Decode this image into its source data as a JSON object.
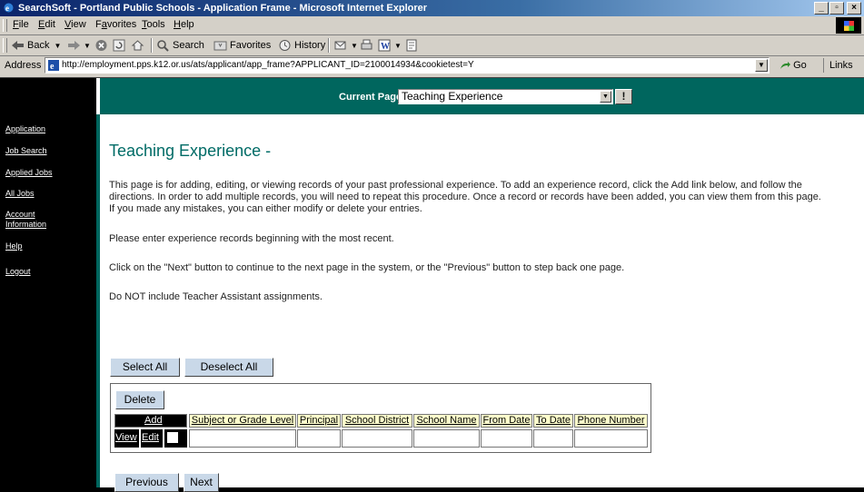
{
  "window": {
    "title": "SearchSoft - Portland Public Schools - Application Frame - Microsoft Internet Explorer"
  },
  "menubar": {
    "items": [
      {
        "hot": "F",
        "rest": "ile"
      },
      {
        "hot": "E",
        "rest": "dit"
      },
      {
        "hot": "V",
        "rest": "iew"
      },
      {
        "pre": "F",
        "hot": "a",
        "rest": "vorites"
      },
      {
        "hot": "T",
        "rest": "ools"
      },
      {
        "hot": "H",
        "rest": "elp"
      }
    ]
  },
  "toolbar": {
    "back": "Back",
    "search": "Search",
    "favorites": "Favorites",
    "history": "History"
  },
  "addressbar": {
    "label": "Address",
    "url": "http://employment.pps.k12.or.us/ats/applicant/app_frame?APPLICANT_ID=2100014934&cookietest=Y",
    "go": "Go",
    "links": "Links"
  },
  "sidebar": {
    "items": [
      {
        "label": "Application"
      },
      {
        "label": "Job Search"
      },
      {
        "label": "Applied Jobs"
      },
      {
        "label": "All Jobs"
      },
      {
        "label": "Account"
      },
      {
        "label": "Information"
      },
      {
        "label": "Help"
      },
      {
        "label": "Logout"
      }
    ]
  },
  "topband": {
    "current_page_label": "Current Page:",
    "current_page_value": "Teaching Experience",
    "go_symbol": "!"
  },
  "content": {
    "title": "Teaching Experience -",
    "intro_lines": [
      "This page is for adding, editing, or viewing records of your past professional experience. To add an experience record, click the Add link below, and follow the",
      "directions. In order to add multiple records, you will need to repeat this procedure. Once a record or records have been added, you can view them from this page.",
      "If you made any mistakes, you can either modify or delete your entries."
    ],
    "para2": "Please enter experience records beginning with the most recent.",
    "para3": "Click on the \"Next\" button to continue to the next page in the system, or the \"Previous\" button to step back one page.",
    "para4": "Do NOT include Teacher Assistant assignments.",
    "select_all": "Select All",
    "deselect_all": "Deselect All",
    "delete": "Delete",
    "previous": "Previous",
    "next": "Next"
  },
  "table": {
    "add_label": "Add",
    "columns": [
      "Subject or Grade Level",
      "Principal",
      "School District",
      "School Name",
      "From Date",
      "To Date",
      "Phone Number"
    ],
    "row_actions": {
      "view": "View",
      "edit": "Edit"
    }
  }
}
